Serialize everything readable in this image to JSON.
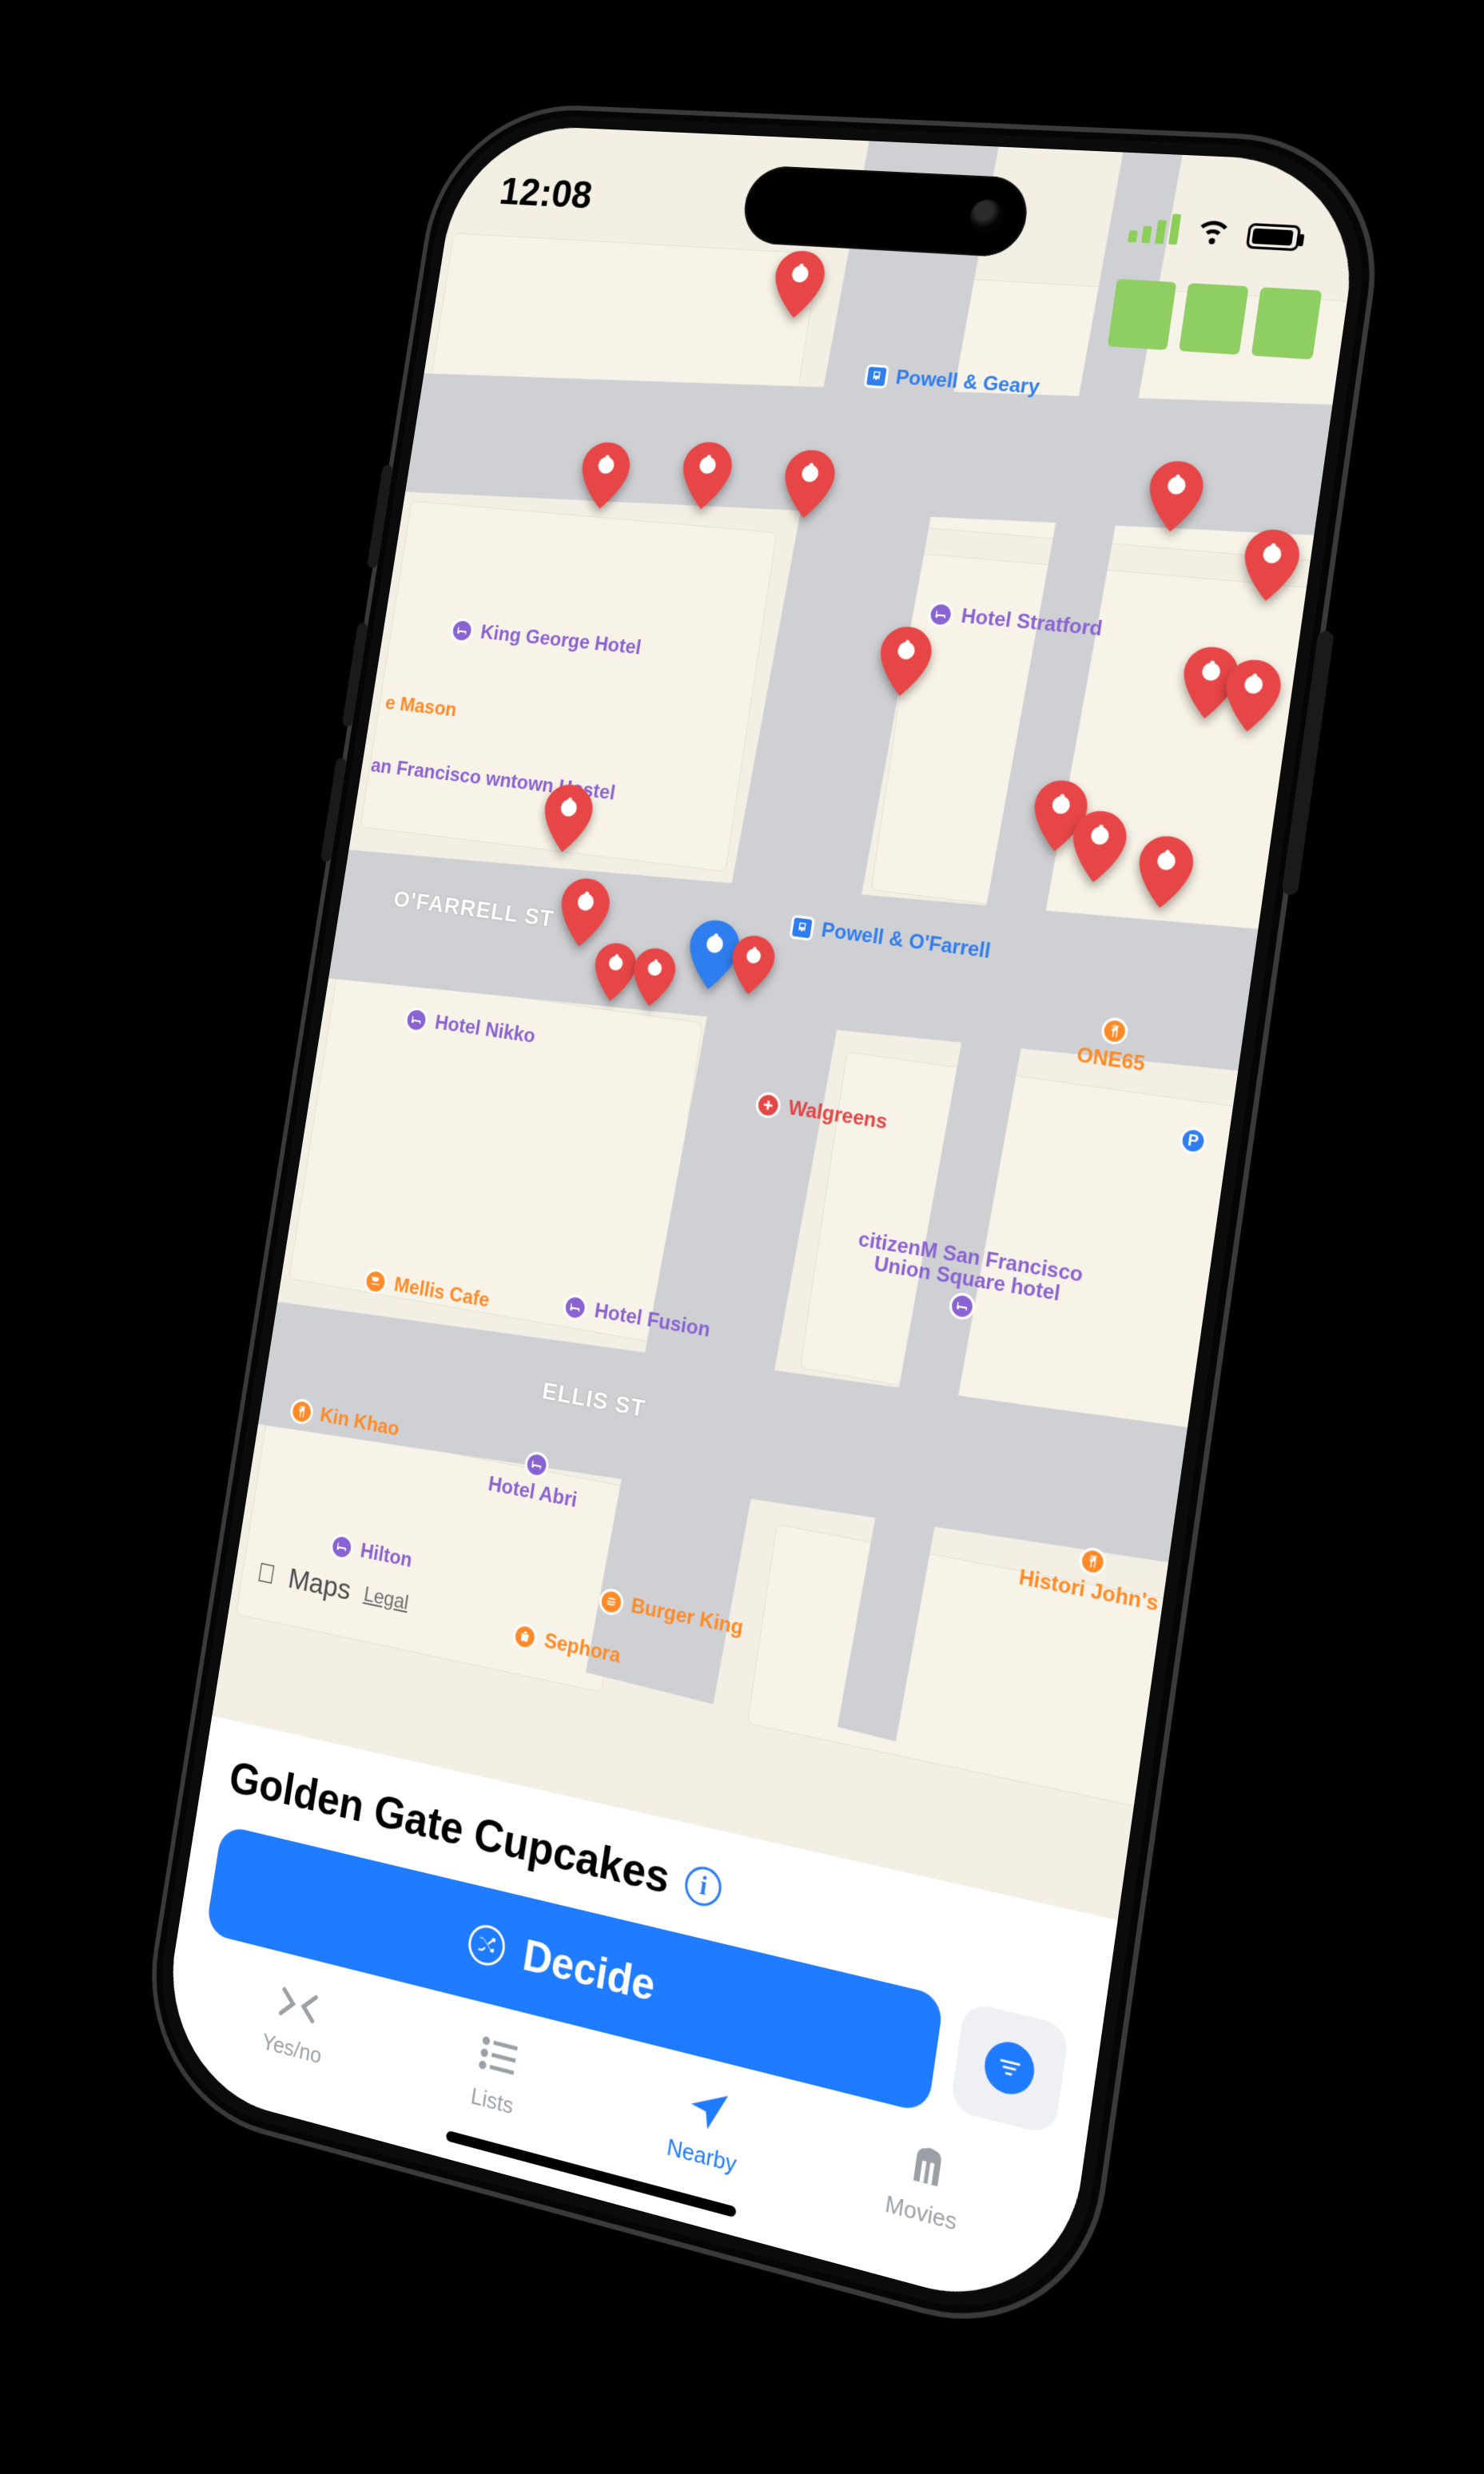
{
  "status": {
    "time": "12:08"
  },
  "map": {
    "attribution": {
      "brand": "Maps",
      "legal": "Legal"
    },
    "streets": {
      "ofarrell": "O'FARRELL ST",
      "ellis": "ELLIS ST"
    },
    "transitStops": {
      "powellGeary": "Powell & Geary",
      "powellOfarrell": "Powell & O'Farrell"
    },
    "pois": {
      "hotelStratford": "Hotel Stratford",
      "kingGeorge": "King George Hotel",
      "sfHostel": "an Francisco wntown Hostel",
      "mason": "e Mason",
      "hotelNikko": "Hotel Nikko",
      "walgreens": "Walgreens",
      "one65": "ONE65",
      "citizenM": "citizenM San Francisco Union Square hotel",
      "hotelFusion": "Hotel Fusion",
      "mellisCafe": "Mellis Cafe",
      "hotelAbri": "Hotel Abri",
      "kinKhao": "Kin Khao",
      "historicJohns": "Histori John's",
      "hilton": "Hilton",
      "burgerKing": "Burger King",
      "sephora": "Sephora",
      "parking": "P"
    }
  },
  "sheet": {
    "title": "Golden Gate Cupcakes",
    "decide_label": "Decide"
  },
  "tabs": {
    "yesno": "Yes/no",
    "lists": "Lists",
    "nearby": "Nearby",
    "movies": "Movies"
  }
}
